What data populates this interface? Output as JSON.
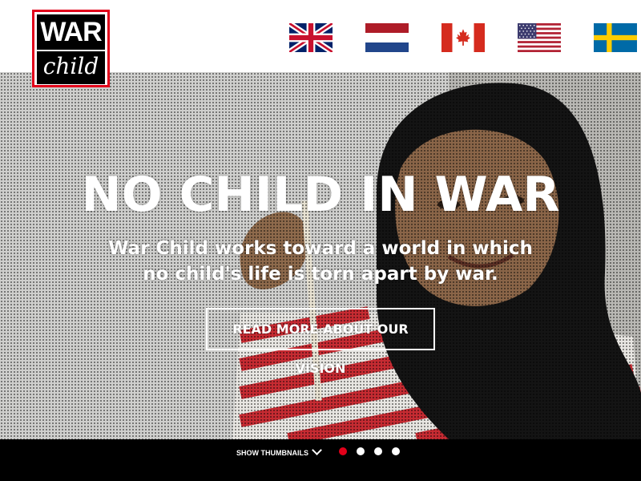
{
  "header": {
    "logo": {
      "line1": "WAR",
      "line2": "child"
    },
    "flags": [
      {
        "name": "United Kingdom"
      },
      {
        "name": "Netherlands"
      },
      {
        "name": "Canada"
      },
      {
        "name": "United States"
      },
      {
        "name": "Sweden"
      }
    ]
  },
  "hero": {
    "title": "NO CHILD IN WAR",
    "subtitle": "War Child works toward a world in which no child's life is torn apart by war.",
    "cta_label": "READ MORE ABOUT OUR VISION"
  },
  "carousel": {
    "show_thumbnails_label": "SHOW THUMBNAILS",
    "slide_count": 4,
    "active_slide": 1
  },
  "colors": {
    "brand_red": "#e2001a",
    "bar_black": "#000000",
    "text_white": "#ffffff"
  }
}
